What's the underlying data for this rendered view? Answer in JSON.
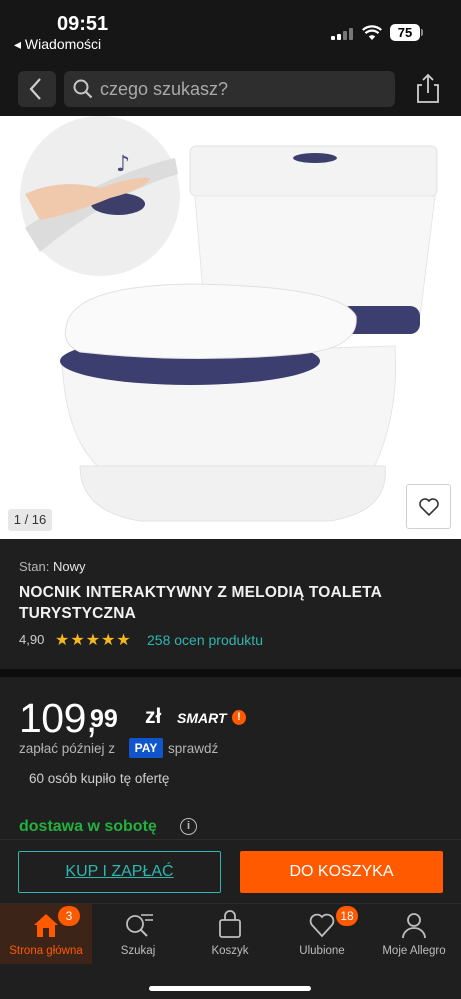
{
  "status_bar": {
    "time": "09:51",
    "back_app": "◂ Wiadomości",
    "battery": "75"
  },
  "header": {
    "search_placeholder": "czego szukasz?"
  },
  "gallery": {
    "counter": "1 / 16"
  },
  "product": {
    "condition_label": "Stan:",
    "condition_value": "Nowy",
    "title": "NOCNIK INTERAKTYWNY Z MELODIĄ TOALETA TURYSTYCZNA",
    "rating": "4,90",
    "stars": "★★★★★",
    "reviews": "258 ocen produktu"
  },
  "price": {
    "main": "109,",
    "decimal": "99",
    "currency": "zł",
    "smart_label": "SMART",
    "smart_mark": "!",
    "pay_later_prefix": "zapłać później z",
    "pay_badge": "PAY",
    "pay_check": "sprawdź",
    "bought": "60 osób kupiło tę ofertę"
  },
  "delivery": {
    "label": "dostawa w sobotę",
    "info": "i"
  },
  "actions": {
    "buy_now": "KUP I ZAPŁAĆ",
    "add_to_cart": "DO KOSZYKA"
  },
  "tabbar": {
    "home": "Strona główna",
    "home_badge": "3",
    "search": "Szukaj",
    "cart": "Koszyk",
    "favorites": "Ulubione",
    "favorites_badge": "18",
    "account": "Moje Allegro"
  },
  "colors": {
    "accent": "#ff5a00",
    "teal": "#2fb6b0",
    "green": "#24b03e",
    "star": "#f5b921"
  }
}
